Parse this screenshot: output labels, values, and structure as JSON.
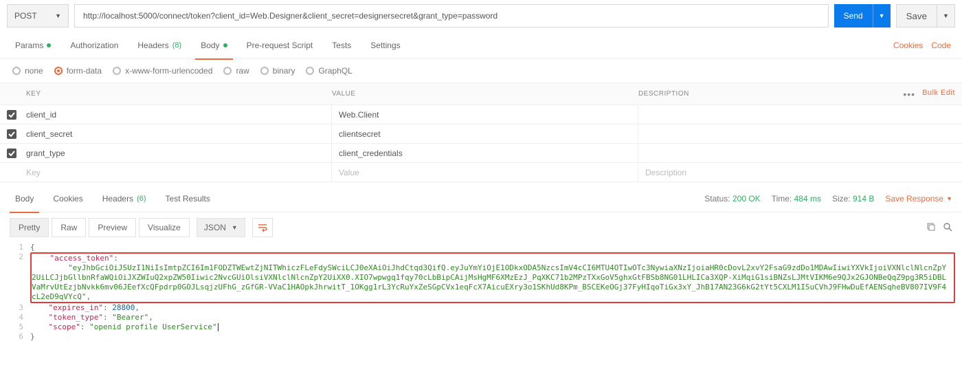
{
  "request": {
    "method": "POST",
    "url": "http://localhost:5000/connect/token?client_id=Web.Designer&client_secret=designersecret&grant_type=password",
    "send_label": "Send",
    "save_label": "Save"
  },
  "request_tabs": {
    "params": "Params",
    "authorization": "Authorization",
    "headers": "Headers",
    "headers_count": "(8)",
    "body": "Body",
    "prerequest": "Pre-request Script",
    "tests": "Tests",
    "settings": "Settings",
    "cookies": "Cookies",
    "code": "Code"
  },
  "body_types": {
    "none": "none",
    "formdata": "form-data",
    "urlencoded": "x-www-form-urlencoded",
    "raw": "raw",
    "binary": "binary",
    "graphql": "GraphQL"
  },
  "kvd_headers": {
    "key": "KEY",
    "value": "VALUE",
    "desc": "DESCRIPTION",
    "bulk": "Bulk Edit"
  },
  "kvd_rows": [
    {
      "key": "client_id",
      "value": "Web.Client",
      "desc": ""
    },
    {
      "key": "client_secret",
      "value": "clientsecret",
      "desc": ""
    },
    {
      "key": "grant_type",
      "value": "client_credentials",
      "desc": ""
    }
  ],
  "kvd_placeholder": {
    "key": "Key",
    "value": "Value",
    "desc": "Description"
  },
  "response_tabs": {
    "body": "Body",
    "cookies": "Cookies",
    "headers": "Headers",
    "headers_count": "(6)",
    "test_results": "Test Results"
  },
  "response_meta": {
    "status_label": "Status:",
    "status_value": "200 OK",
    "time_label": "Time:",
    "time_value": "484 ms",
    "size_label": "Size:",
    "size_value": "914 B",
    "save_response": "Save Response"
  },
  "viewer": {
    "pretty": "Pretty",
    "raw": "Raw",
    "preview": "Preview",
    "visualize": "Visualize",
    "type": "JSON"
  },
  "json_response": {
    "access_token_key": "\"access_token\"",
    "access_token_value": "\"eyJhbGciOiJSUzI1NiIsImtpZCI6Im1FODZTWEwtZjNITWhiczFLeFdySWciLCJ0eXAiOiJhdCtqd3QifQ.eyJuYmYiOjE1ODkxODA5NzcsImV4cCI6MTU4OTIwOTc3NywiaXNzIjoiaHR0cDovL2xvY2FsaG9zdDo1MDAwIiwiYXVkIjoiVXNlclNlcnZpY2UiLCJjbGllbnRfaWQiOiJXZWIuQ2xpZW50Iiwic2NvcGUiOlsiVXNlclNlcnZpY2UiXX0.XIO7wpwgq1fqy70cLbBipCAijMsHgMF6XMzEzJ_PqXKC71b2MPzTXxGoV5ghxGtFBSb8NG01LHLICa3XQP-XiMqiG1siBNZsLJMtVIKM6e9QJx2GJONBeQqZ9pg3R5iDBLVaMrvUtEzjbNvkk6mv06JEefXcQFpdrp0GOJLsqjzUFhG_zGfGR-VVaC1HAOpkJhrwitT_1OKgg1rL3YcRuYxZeSGpCVx1eqFcX7AicuEXry3o1SKhUd8KPm_BSCEKeOGj37FyHIqoTiGx3xY_JhB17AN23G6kG2tYt5CXLM1ISuCVhJ9FHwDuEfAENSqheBV807IV9F4cL2eD9qVYcQ\"",
    "expires_in_key": "\"expires_in\"",
    "expires_in_value": "28800",
    "token_type_key": "\"token_type\"",
    "token_type_value": "\"Bearer\"",
    "scope_key": "\"scope\"",
    "scope_value": "\"openid profile UserService\""
  }
}
